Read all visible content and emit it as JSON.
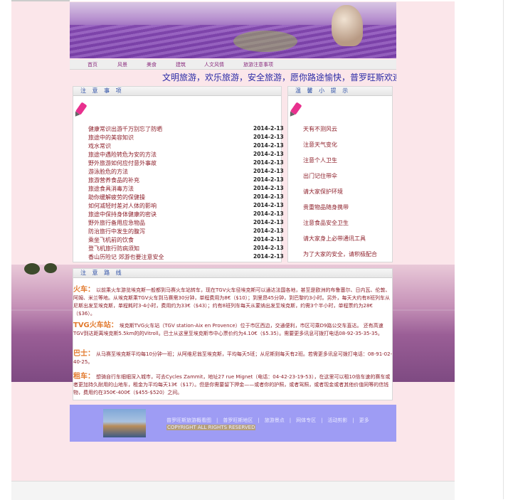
{
  "nav": [
    "首页",
    "风景",
    "美食",
    "建筑",
    "人文风情",
    "旅游注意事项"
  ],
  "marquee": "文明旅游，欢乐旅游，安全旅游，愿你路途愉快，普罗旺斯欢迎您",
  "notice": {
    "title": "注 意 事 项",
    "items": [
      {
        "title": "健康常识出游千万别忘了防晒",
        "date": "2014-2-13"
      },
      {
        "title": "旅途中的美容知识",
        "date": "2014-2-13"
      },
      {
        "title": "戏水常识",
        "date": "2014-2-13"
      },
      {
        "title": "旅途中遇险转危为安的方法",
        "date": "2014-2-13"
      },
      {
        "title": "野外旅游如何应付意外事故",
        "date": "2014-2-13"
      },
      {
        "title": "游泳脸危的方法",
        "date": "2014-2-13"
      },
      {
        "title": "旅游营养食品的补充",
        "date": "2014-2-13"
      },
      {
        "title": "旅途食具消毒方法",
        "date": "2014-2-13"
      },
      {
        "title": "助你缓解疲劳的保健操",
        "date": "2014-2-13"
      },
      {
        "title": "如何减轻时差对人体的影响",
        "date": "2014-2-13"
      },
      {
        "title": "旅途中保持身体健康的密诀",
        "date": "2014-2-13"
      },
      {
        "title": "野外旅行备用应急物品",
        "date": "2014-2-13"
      },
      {
        "title": "防治旅行中发生的腹泻",
        "date": "2014-2-13"
      },
      {
        "title": "乘坐飞机前的饮食",
        "date": "2014-2-13"
      },
      {
        "title": "登飞机旅行防病须知",
        "date": "2014-2-13"
      },
      {
        "title": "香山历险记 郊游也要注意安全",
        "date": "2014-2-13"
      }
    ]
  },
  "tips": {
    "title": "温 馨 小 提 示",
    "items": [
      "天有不测风云",
      "注意天气变化",
      "注意个人卫生",
      "出门记住带伞",
      "请大家保护环境",
      "贵重物品随身携带",
      "注意食品安全卫生",
      "请大家身上必带通讯工具",
      "为了大家的安全，请积极配合"
    ]
  },
  "route": {
    "title": "注 意 路 线",
    "items": [
      {
        "label": "火车：",
        "text": "以前乘火车游览埃克斯一般都到马赛火车站转车，现在TGV火车径埃克斯可以通达法国各地，甚至是欧洲的布鲁塞尔、日内瓦、伦敦、阿姆、米兰等地。从埃克斯乘TGV火车到马赛需30分钟，单程费用为8€（$10）；到里昂45分钟，到巴黎约3小时。另外，每天大约有8班列车从尼斯出发至埃克斯，单程耗时3-4小时，费用约为33€（$43）；约有8班列车每天从蒙纳出发至埃克斯，约需3个半小时，单程票约为28€（$36）。"
      },
      {
        "label": "TVG火车站：",
        "text": "埃克斯TVG火车站（TGV station-Aix en Provence）位于市区西边，交通便利，市区可乘D9路公交车直达。 还有高速TGV到达距离埃克斯5.5km的的Vitroll。巴士从这里至埃克斯市中心票价约为4.10€（$5.35）。需要更多讯息可拨打电话08-92-35-35-35。"
      },
      {
        "label": "巴士：",
        "text": "从马赛至埃克斯平均每10分钟一班；从阿维尼翁至埃克斯，平均每天5班；从尼斯则每天有2班。若需更多讯息可拨打电话：08-91-02-40-25。"
      },
      {
        "label": "租车：",
        "text": "想骑自行车细细深入城市，可去Cycles Zammit，地址27 rue Mignet（电话：04-42-23-19-53），在这里可以租10倍车速的赛车或者更加持久耐用的山地车，租金为平均每天13€（$17）。但是你需要留下押金——或者你的护照，或者驾照，或者现金或者其他价值同等的信钱物，费用约在350€-400€（$455-$520）之间。"
      }
    ]
  },
  "footer": {
    "links": "普罗旺斯旅游概看图　|　普罗旺斯地区　|　旅游景点　|　网体专区　|　活动剪影　|　更多",
    "copyright": "COPYRIGHT ALL RIGHTS RESERVED"
  }
}
